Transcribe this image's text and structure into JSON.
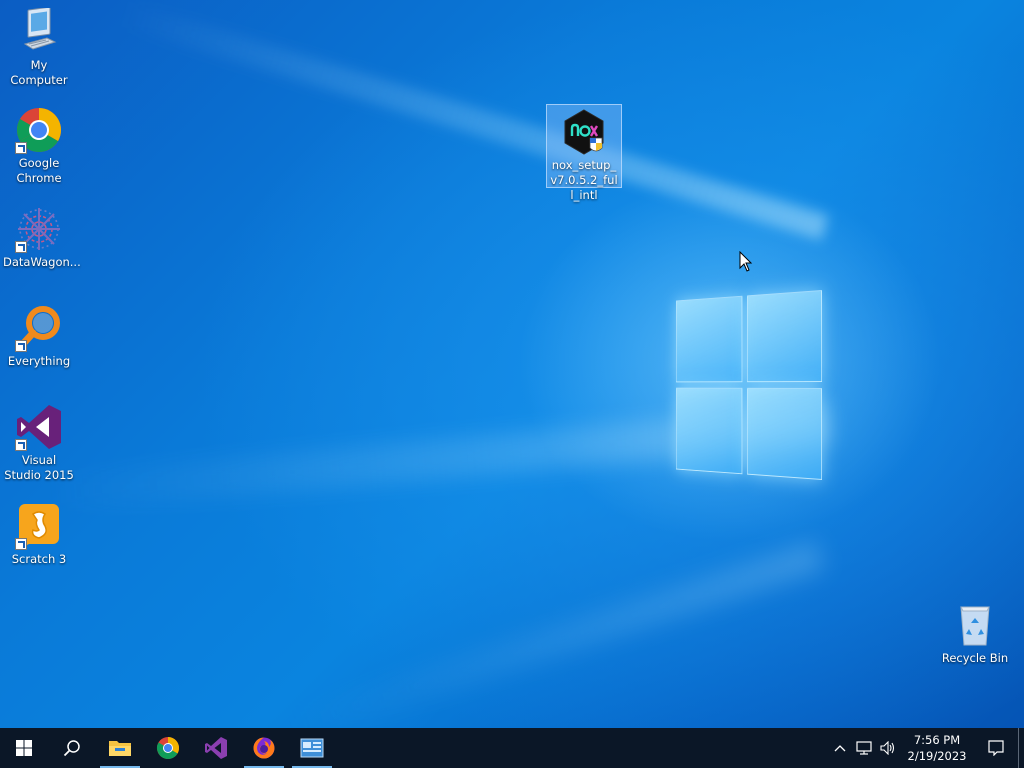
{
  "desktop": {
    "icons": [
      {
        "label": "My Computer",
        "icon": "computer-icon"
      },
      {
        "label": "Google Chrome",
        "icon": "chrome-icon",
        "shortcut": true
      },
      {
        "label": "DataWagon...",
        "icon": "datawagon-icon",
        "shortcut": true
      },
      {
        "label": "Everything",
        "icon": "everything-search-icon",
        "shortcut": true
      },
      {
        "label": "Visual Studio 2015",
        "icon": "visual-studio-icon",
        "shortcut": true
      },
      {
        "label": "Scratch 3",
        "icon": "scratch-icon",
        "shortcut": true
      }
    ],
    "selected_file": {
      "label": "nox_setup_v7.0.5.2_full_intl",
      "icon": "nox-installer-icon"
    },
    "recycle_bin": {
      "label": "Recycle Bin",
      "icon": "recycle-bin-icon"
    }
  },
  "taskbar": {
    "start": "windows-start-icon",
    "search": "search-icon",
    "pinned": [
      {
        "name": "file-explorer-icon",
        "running": true
      },
      {
        "name": "chrome-icon",
        "running": false
      },
      {
        "name": "visual-studio-icon",
        "running": false
      },
      {
        "name": "firefox-icon",
        "running": true
      },
      {
        "name": "app-window-icon",
        "running": true
      }
    ],
    "tray": {
      "time": "7:56 PM",
      "date": "2/19/2023"
    }
  },
  "colors": {
    "desktop_blue": "#0a7ad8",
    "taskbar": "#0b1727",
    "running_indicator": "#76b9ed"
  }
}
